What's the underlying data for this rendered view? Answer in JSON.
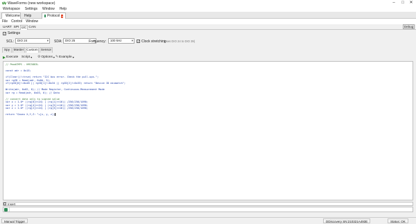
{
  "window": {
    "title": "WaveForms",
    "workspace": "(new workspace)",
    "controls": {
      "minimize": "–",
      "maximize": "□",
      "close": "✕"
    }
  },
  "main_menu": [
    "Workspace",
    "Settings",
    "Window",
    "Help"
  ],
  "app_tabs": {
    "welcome": "Welcome",
    "help": "Help",
    "protocol": "Protocol",
    "close_glyph": "x"
  },
  "protocol_menu": [
    "File",
    "Control",
    "Window"
  ],
  "protocol_tabs": [
    "UART",
    "SPI",
    "I2C",
    "CAN"
  ],
  "debug_label": "Debug",
  "settings": {
    "label": "Settings",
    "checked": true
  },
  "config": {
    "scl_label": "SCL:",
    "scl_value": "DIO 24",
    "sda_label": "SDA:",
    "sda_value": "DIO 25",
    "frequency_label": "Frequency:",
    "frequency_value": "100 kHz",
    "clock_stretching_label": "Clock stretching",
    "clock_stretching_hint": "(uses DIO 24 to DIO 39)"
  },
  "sub_tabs": [
    "Spy",
    "Master",
    "Custom",
    "Sensor"
  ],
  "toolbar": {
    "execute": "Execute",
    "script": "Script",
    "options": "Options",
    "example": "Example"
  },
  "editor_lines": [
    "// PmodCMPS - HMC5883L",
    "",
    "const adr = 0x1E;",
    "",
    "if(Clear()!=true) return \"I2C bus error. Check the pull-ups.\";",
    "var rgID = Read(adr, 0x0A, 3);",
    "if(rgID[0]!=0x48 || rgID[1]!=0x34 || rgID[2]!=0x33) return \"Device ID mismatch\";",
    "",
    "Write(adr, 0x02, 0); // Mode Register, Continuous-Measurement Mode",
    "var rg = Read(adr, 0x03, 6); // Data",
    "",
    "// convert data only to signed value",
    "var x = 1.0* ((rg[0]<<24) | (rg[1]<<16)) /256/256/1090;",
    "var y = 1.0* ((rg[4]<<24) | (rg[5]<<16)) /256/256/1090;",
    "var z = 1.0* ((rg[2]<<24) | (rg[3]<<16)) /256/256/1090;",
    "",
    "return \"Gauss X,Y,Z: \"+[x, y, z];"
  ],
  "output": {
    "label": "Insert"
  },
  "status": {
    "trigger": "Manual Trigger",
    "device": "DDiscovery SN:210321A493E",
    "state": "Status: OK"
  }
}
